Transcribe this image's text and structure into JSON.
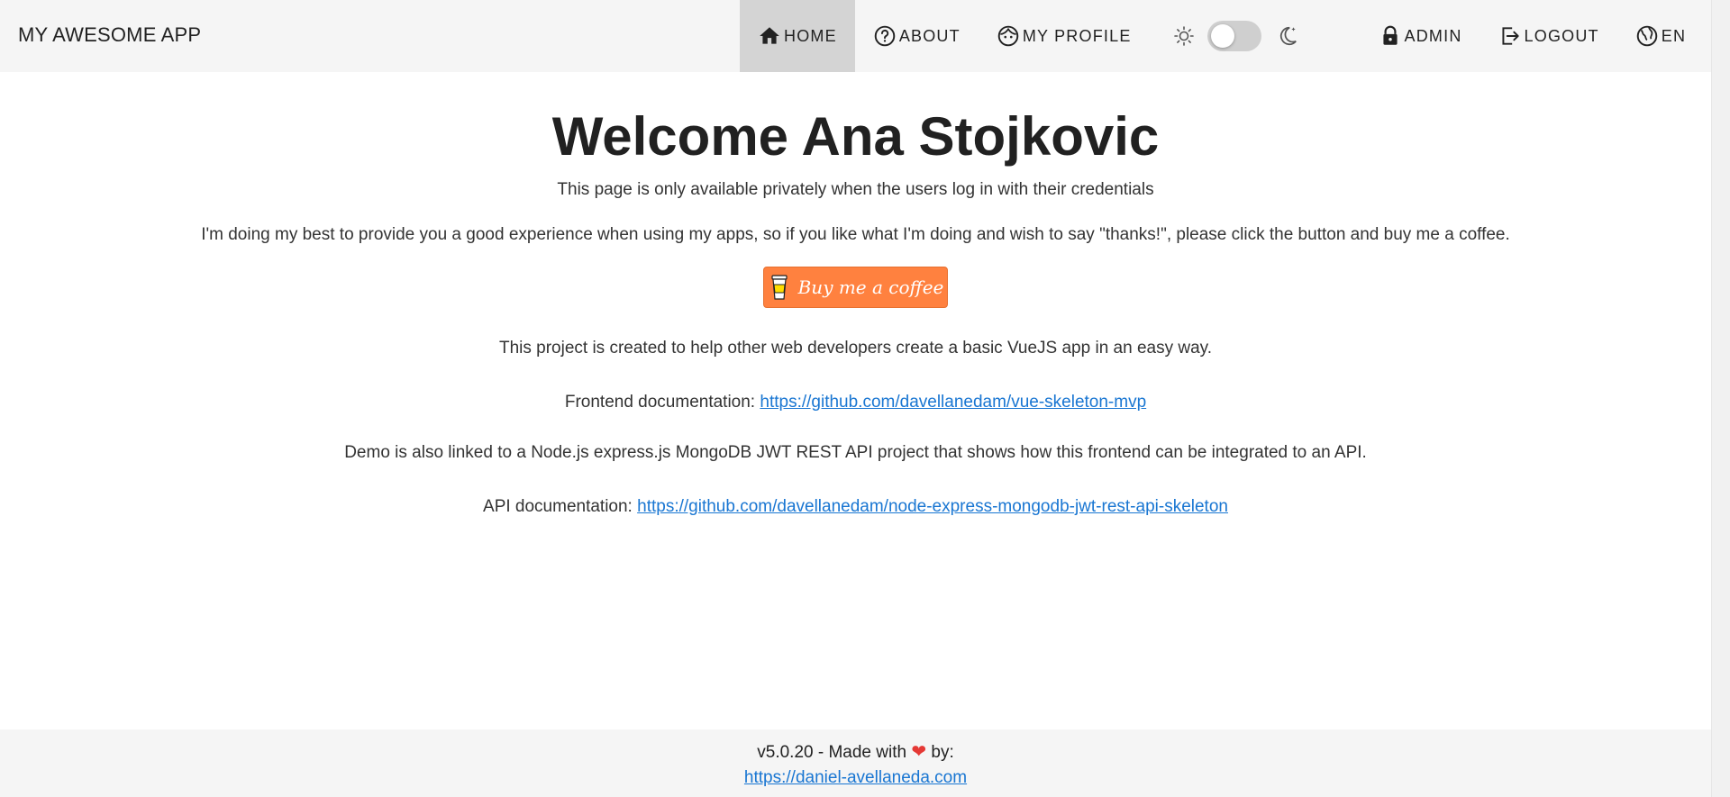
{
  "header": {
    "app_title": "MY AWESOME APP",
    "nav": {
      "home": "HOME",
      "about": "ABOUT",
      "my_profile": "MY PROFILE",
      "admin": "ADMIN",
      "logout": "LOGOUT",
      "language": "EN"
    },
    "theme_toggle": {
      "state": "light"
    }
  },
  "main": {
    "welcome": "Welcome Ana Stojkovic",
    "private_note": "This page is only available privately when the users log in with their credentials",
    "support_text": "I'm doing my best to provide you a good experience when using my apps, so if you like what I'm doing and wish to say \"thanks!\", please click the button and buy me a coffee.",
    "coffee_button": "Buy me a coffee",
    "project_text": "This project is created to help other web developers create a basic VueJS app in an easy way.",
    "frontend_label": "Frontend documentation:",
    "frontend_link": "https://github.com/davellanedam/vue-skeleton-mvp",
    "demo_text": "Demo is also linked to a Node.js express.js MongoDB JWT REST API project that shows how this frontend can be integrated to an API.",
    "api_label": "API documentation:",
    "api_link": "https://github.com/davellanedam/node-express-mongodb-jwt-rest-api-skeleton"
  },
  "footer": {
    "version_text": "v5.0.20 - Made with",
    "by_text": "by:",
    "author_link": "https://daniel-avellaneda.com"
  },
  "colors": {
    "accent_link": "#1976d2",
    "coffee_orange": "#ff813f",
    "heart": "#e53935"
  }
}
